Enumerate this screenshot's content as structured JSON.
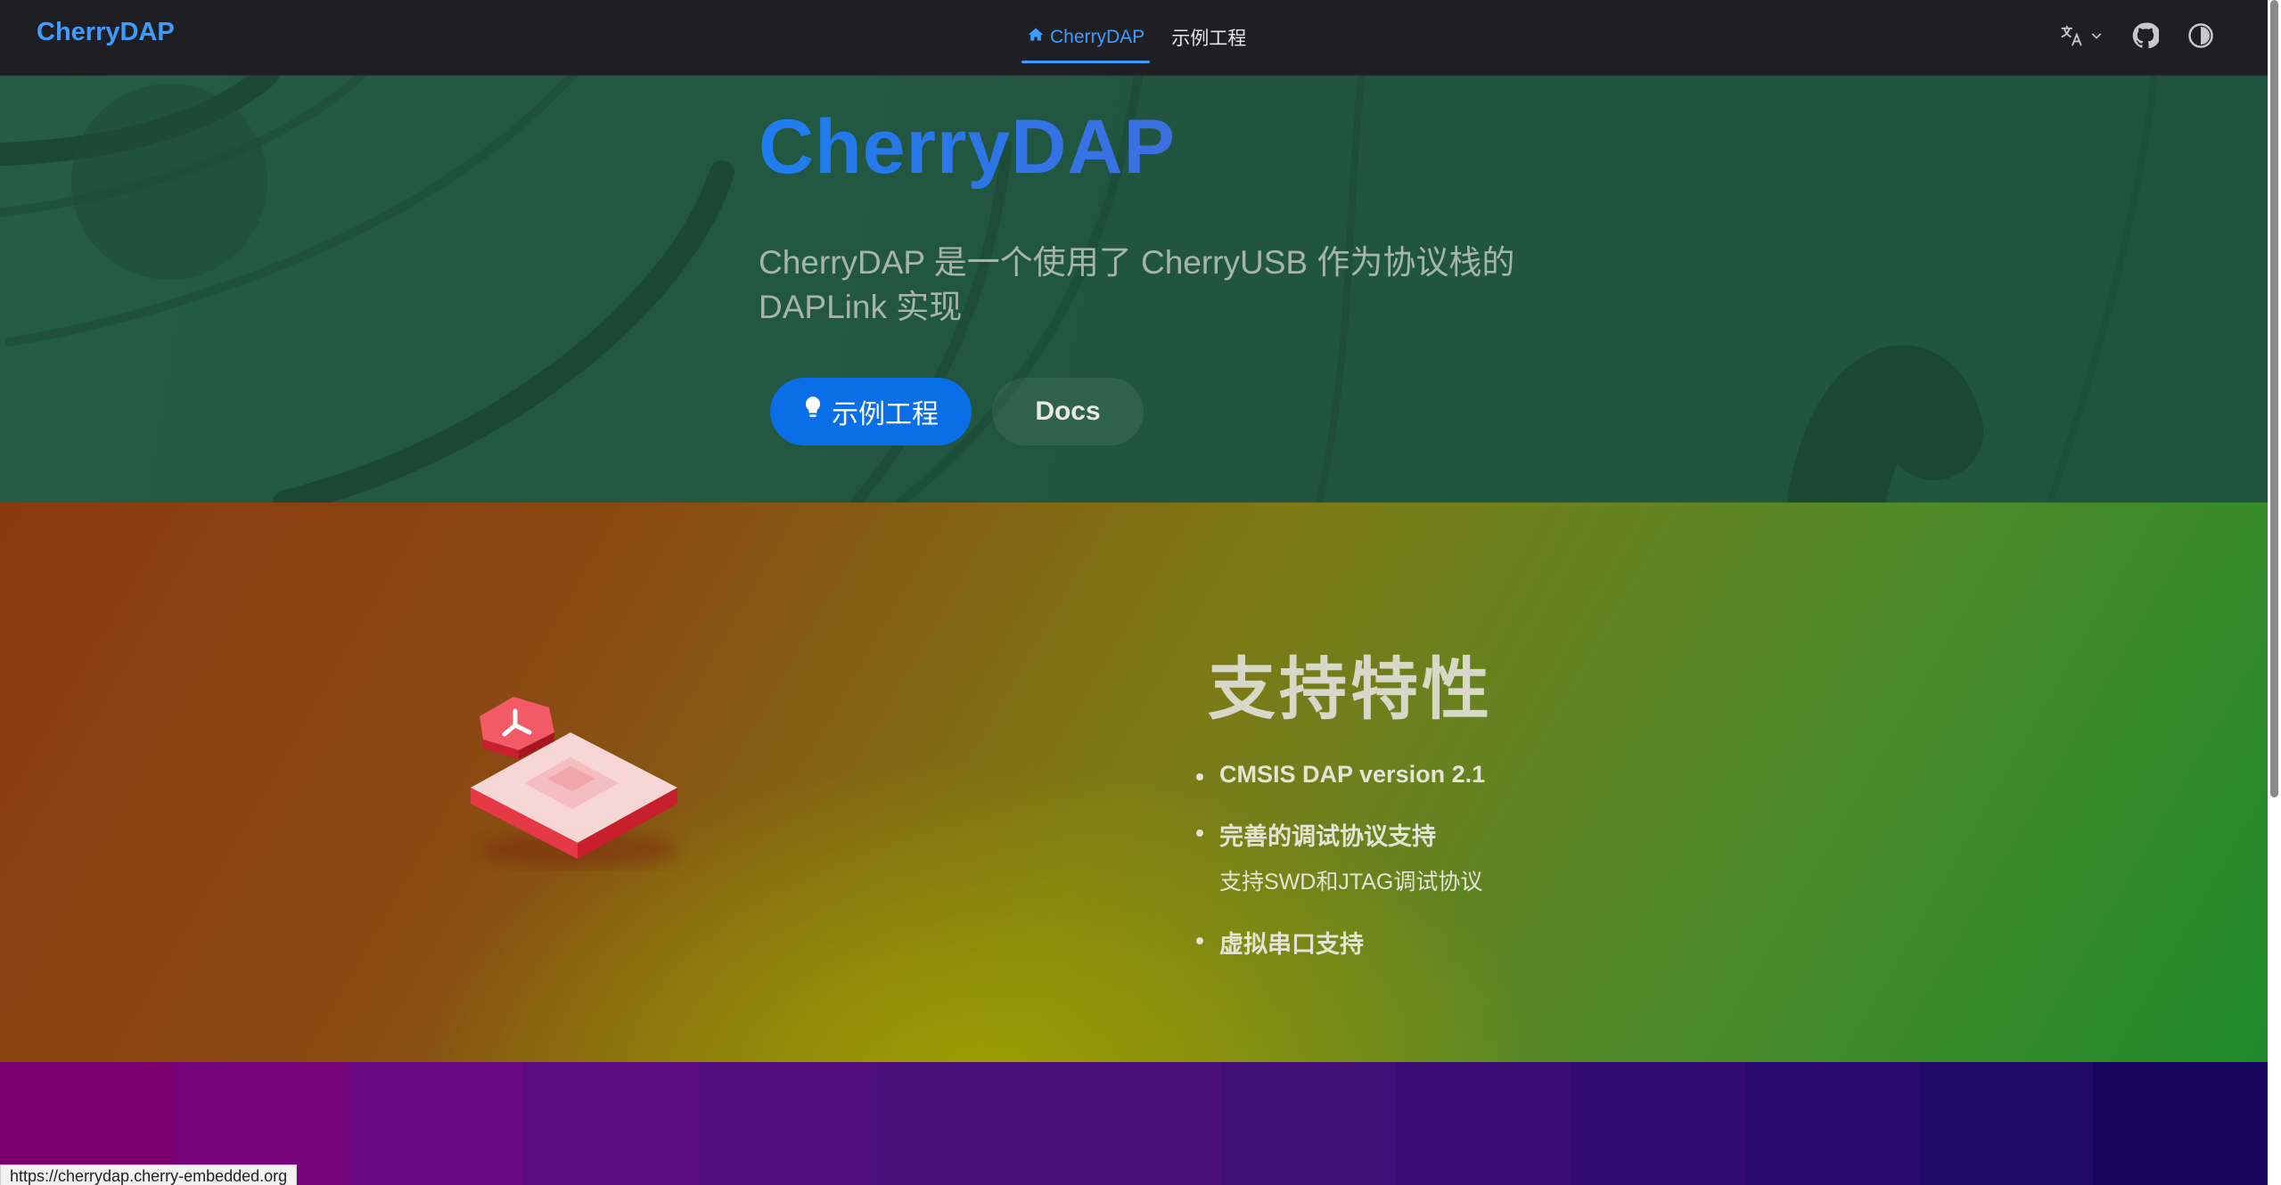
{
  "navbar": {
    "brand": "CherryDAP",
    "links": [
      {
        "label": "CherryDAP",
        "active": true
      },
      {
        "label": "示例工程",
        "active": false
      }
    ]
  },
  "hero": {
    "title": "CherryDAP",
    "tagline": "CherryDAP 是一个使用了 CherryUSB 作为协议栈的 DAPLink 实现",
    "primary_button": "示例工程",
    "secondary_button": "Docs"
  },
  "features": {
    "title": "支持特性",
    "items": [
      {
        "label": "CMSIS DAP version 2.1"
      },
      {
        "label": "完善的调试协议支持",
        "desc": "支持SWD和JTAG调试协议"
      },
      {
        "label": "虚拟串口支持"
      }
    ]
  },
  "status_bar": {
    "url": "https://cherrydap.cherry-embedded.org"
  },
  "colors": {
    "accent": "#3c9dff",
    "button_primary": "#0a6fe6",
    "bottom_strip": [
      "#7a0070",
      "#76047a",
      "#6a0a84",
      "#5c0c80",
      "#520e7c",
      "#4c107a",
      "#481078",
      "#420f76",
      "#3a0d74",
      "#330b70",
      "#2a0a6e",
      "#220a68",
      "#16065e"
    ]
  }
}
